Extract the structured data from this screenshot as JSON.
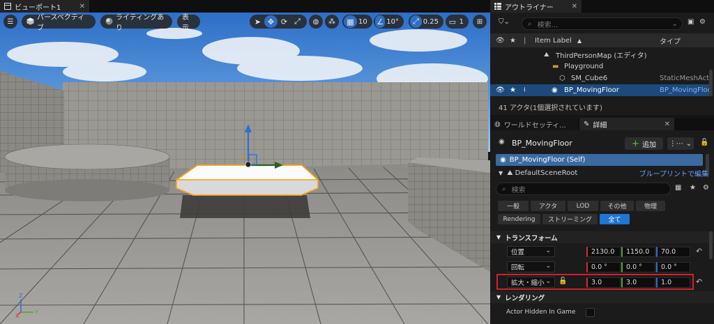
{
  "viewport": {
    "tab_title": "ビューポート1",
    "perspective_label": "パースペクティブ",
    "lighting_label": "ライティングあり",
    "show_label": "表示",
    "grid_snap_value": "10",
    "rotation_snap_value": "10°",
    "scale_snap_value": "0.25",
    "camera_speed_value": "1",
    "axis_labels": {
      "z": "Z",
      "x": "X",
      "y": "Y"
    }
  },
  "outliner": {
    "tab_title": "アウトライナー",
    "search_placeholder": "検索...",
    "col_item_label": "Item Label",
    "col_type": "タイプ",
    "rows": [
      {
        "label": "ThirdPersonMap (エディタ)",
        "type": ""
      },
      {
        "label": "Playground",
        "type": ""
      },
      {
        "label": "SM_Cube6",
        "type": "StaticMeshActor"
      },
      {
        "label": "BP_MovingFloor",
        "type": "BP_MovingFloor"
      }
    ],
    "actor_count": "41 アクタ(1個選択されています)"
  },
  "details": {
    "tab_world": "ワールドセッティ...",
    "tab_details": "詳細",
    "actor_name": "BP_MovingFloor",
    "add_label": "追加",
    "component_self": "BP_MovingFloor (Self)",
    "component_root": "DefaultSceneRoot",
    "edit_in_blueprint": "ブループリントで編集",
    "search_placeholder": "検索",
    "filters": [
      "一般",
      "アクタ",
      "LOD",
      "その他",
      "物理",
      "Rendering",
      "ストリーミング",
      "全て"
    ],
    "transform_section": "トランスフォーム",
    "location_label": "位置",
    "rotation_label": "回転",
    "scale_label": "拡大・縮小",
    "location": [
      "2130.0",
      "1150.0",
      "70.0"
    ],
    "rotation": [
      "0.0 °",
      "0.0 °",
      "0.0 °"
    ],
    "scale": [
      "3.0",
      "3.0",
      "1.0"
    ],
    "rendering_section": "レンダリング",
    "actor_hidden_label": "Actor Hidden In Game"
  },
  "colors": {
    "accent_blue": "#1f75d2",
    "selection_blue": "#1d4a7c",
    "highlight_red": "#d3202a",
    "axis_x": "#c8322a",
    "axis_y": "#5aa02c",
    "axis_z": "#2f6fd6"
  }
}
